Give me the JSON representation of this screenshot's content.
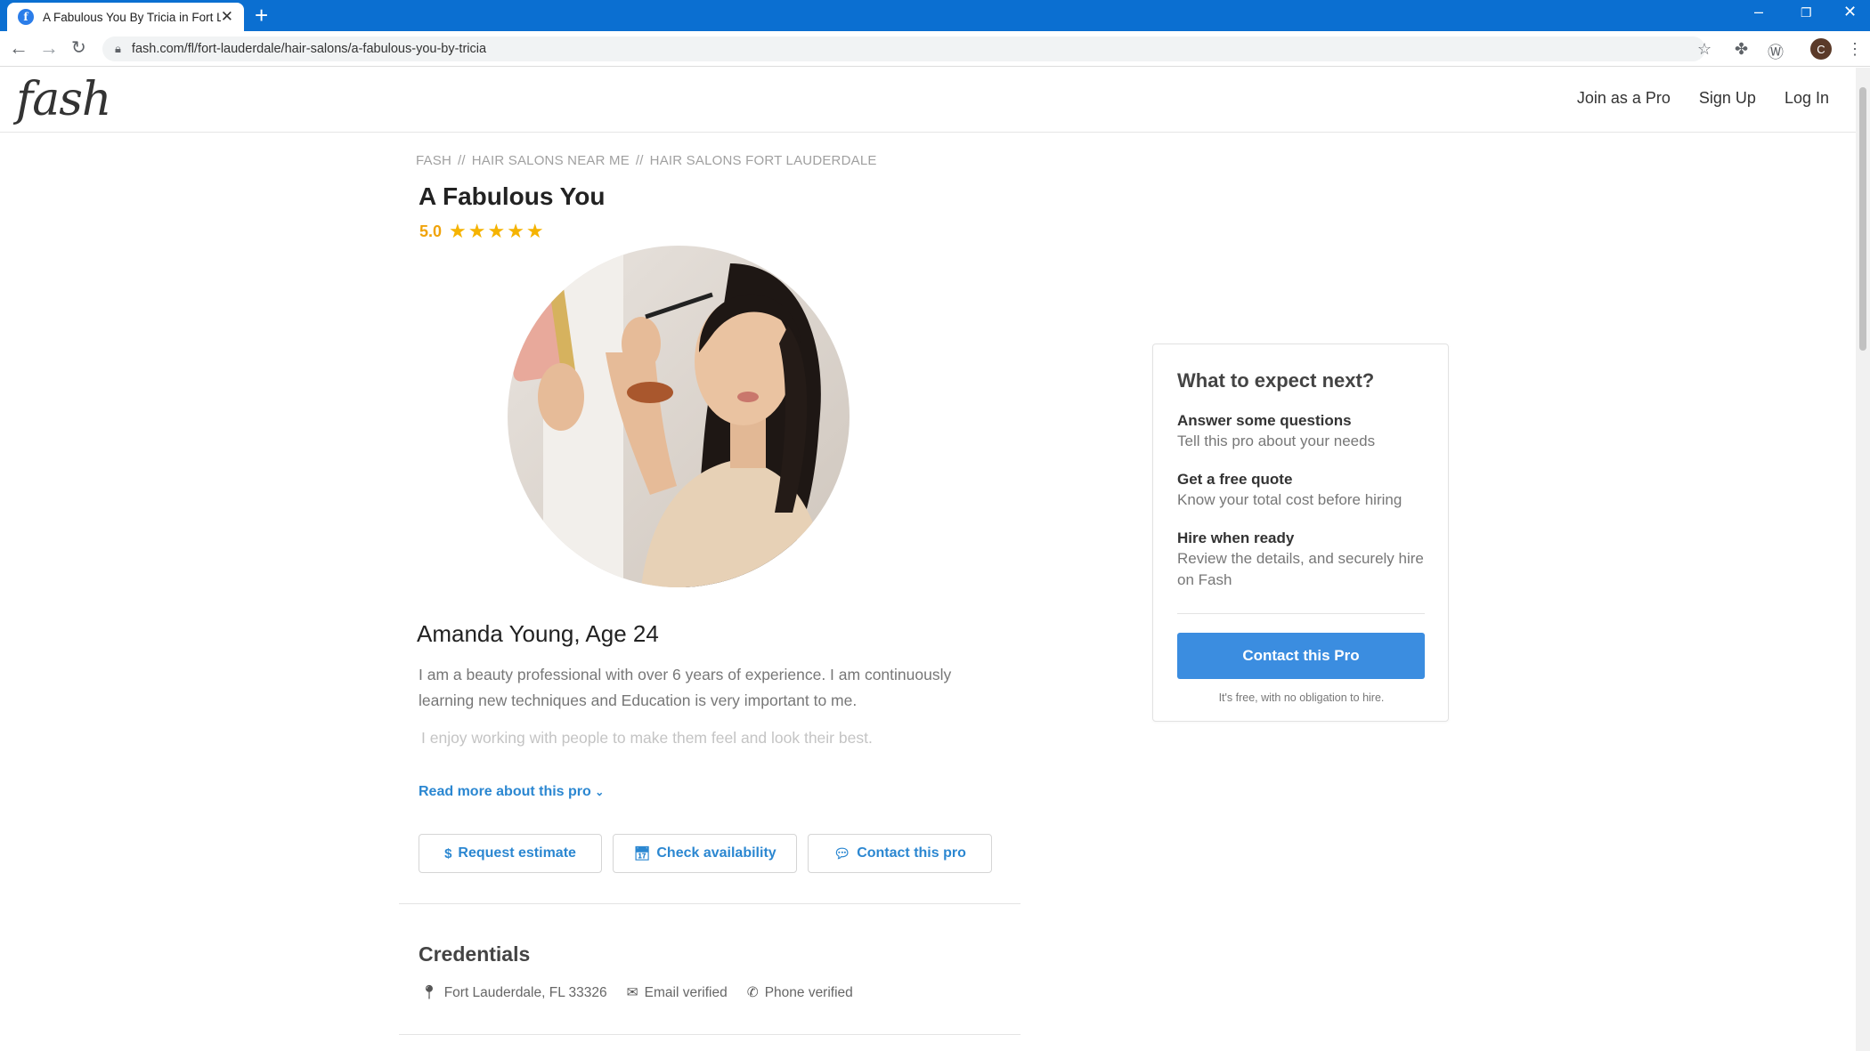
{
  "browser": {
    "tab_title": "A Fabulous You By Tricia in Fort L",
    "url": "fash.com/fl/fort-lauderdale/hair-salons/a-fabulous-you-by-tricia",
    "profile_initial": "C"
  },
  "header": {
    "logo": "fash",
    "nav": [
      "Join as a Pro",
      "Sign Up",
      "Log In"
    ]
  },
  "breadcrumb": [
    "FASH",
    "HAIR SALONS NEAR ME",
    "HAIR SALONS FORT LAUDERDALE"
  ],
  "business": {
    "name": "A Fabulous You",
    "rating": "5.0",
    "stars": 5,
    "pro_name": "Amanda Young, Age 24",
    "bio_1": "I am a beauty professional with over 6 years of experience. I am continuously learning new techniques and Education is very important to me.",
    "bio_2": "I enjoy working with people to make them feel and look their best.",
    "read_more": "Read more about this pro"
  },
  "actions": {
    "request_estimate": "Request estimate",
    "check_availability": "Check availability",
    "contact_pro": "Contact this pro"
  },
  "credentials": {
    "title": "Credentials",
    "location": "Fort Lauderdale, FL 33326",
    "email": "Email verified",
    "phone": "Phone verified"
  },
  "card": {
    "title": "What to expect next?",
    "steps": [
      {
        "heading": "Answer some questions",
        "desc": "Tell this pro about your needs"
      },
      {
        "heading": "Get a free quote",
        "desc": "Know your total cost before hiring"
      },
      {
        "heading": "Hire when ready",
        "desc": "Review the details, and securely hire on Fash"
      }
    ],
    "button": "Contact this Pro",
    "note": "It's free, with no obligation to hire."
  },
  "colors": {
    "accent": "#2b87d1",
    "button": "#3b8de0",
    "star": "#f5b301",
    "browser_bar": "#0b6fd1"
  }
}
